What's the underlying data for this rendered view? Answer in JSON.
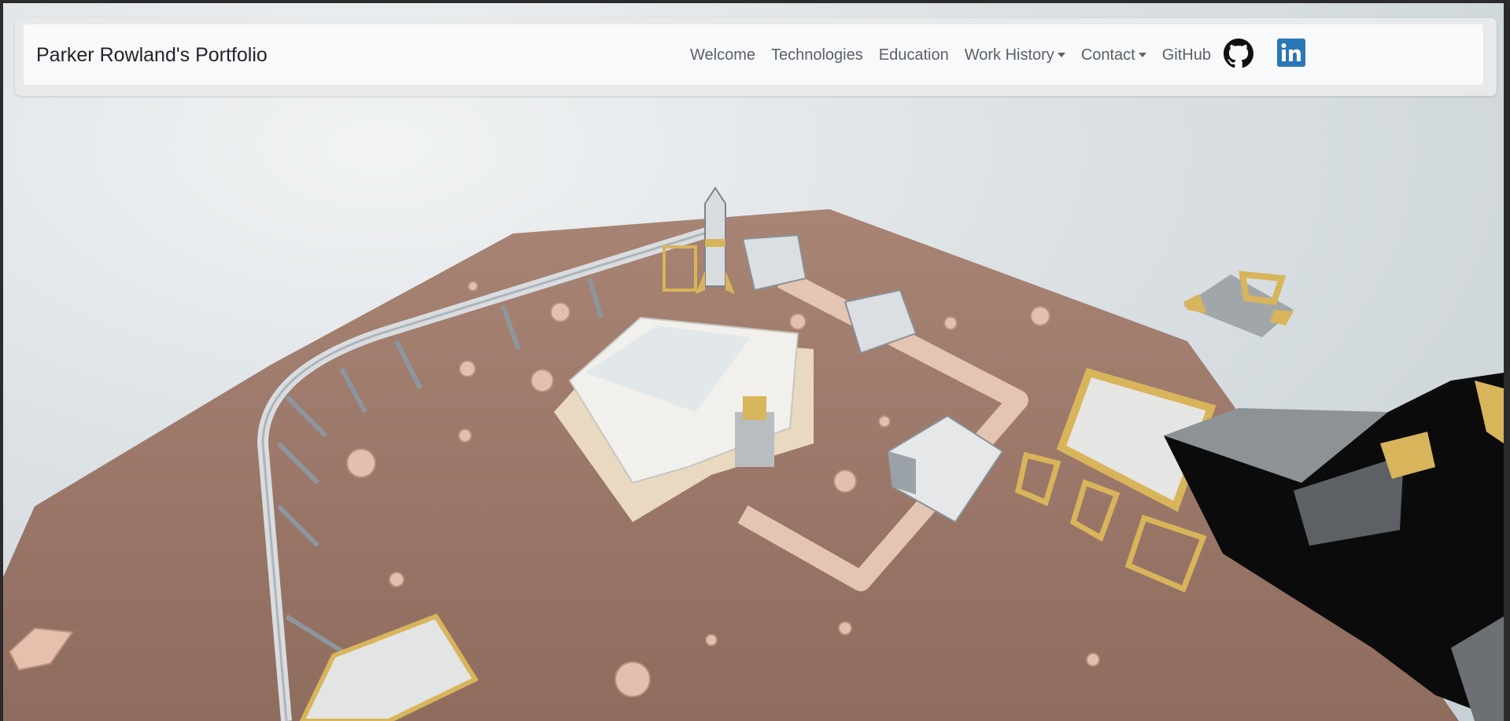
{
  "navbar": {
    "brand": "Parker Rowland's Portfolio",
    "links": [
      {
        "label": "Welcome",
        "dropdown": false
      },
      {
        "label": "Technologies",
        "dropdown": false
      },
      {
        "label": "Education",
        "dropdown": false
      },
      {
        "label": "Work History",
        "dropdown": true
      },
      {
        "label": "Contact",
        "dropdown": true
      },
      {
        "label": "GitHub",
        "dropdown": false
      }
    ],
    "icons": [
      "github-icon",
      "linkedin-icon"
    ]
  },
  "scene": {
    "description_icon": "3d-martian-base-scene"
  },
  "colors": {
    "navbar_bg": "#f8f9fa",
    "ground": "#a07c6c",
    "linkedin": "#2c77b5",
    "accent_gold": "#d8b45a"
  }
}
